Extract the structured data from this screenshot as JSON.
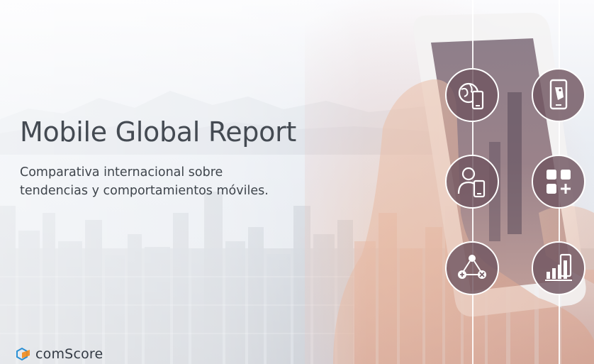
{
  "slide": {
    "title": "Mobile Global Report",
    "subtitle_lines": [
      "Comparativa internacional sobre",
      "tendencias y comportamientos móviles."
    ]
  },
  "brand": {
    "name": "comScore",
    "accent": "#2a8fd4",
    "accent_secondary": "#f08a1c",
    "text_color": "#333a44"
  },
  "icons": [
    {
      "name": "global-mobile-icon"
    },
    {
      "name": "mobile-shopping-icon"
    },
    {
      "name": "mobile-user-icon"
    },
    {
      "name": "apps-icon"
    },
    {
      "name": "travel-network-icon"
    },
    {
      "name": "mobile-growth-chart-icon"
    }
  ],
  "colors": {
    "title": "#444a52",
    "node_fill": "#705660",
    "node_border": "#ffffff"
  }
}
